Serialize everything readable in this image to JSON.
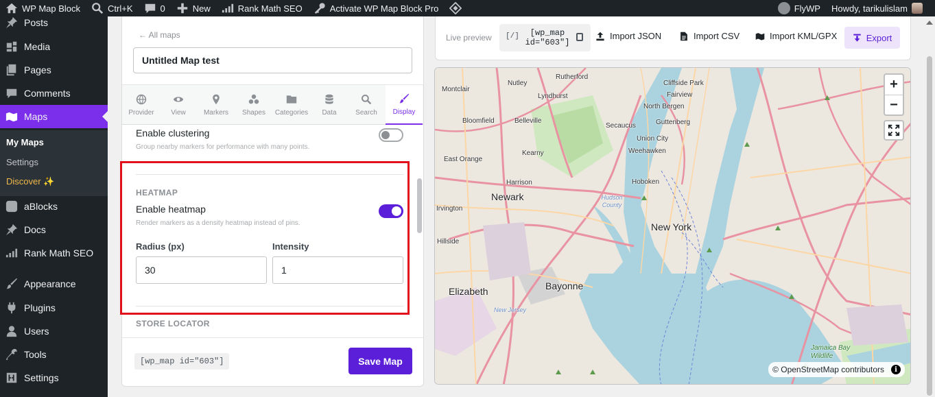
{
  "adminbar": {
    "site_name": "WP Map Block",
    "search_shortcut": "Ctrl+K",
    "comments_count": "0",
    "new_label": "New",
    "rank_math": "Rank Math SEO",
    "activate": "Activate WP Map Block Pro",
    "flywp": "FlyWP",
    "howdy": "Howdy, tarikulislam"
  },
  "sidebar": {
    "items": [
      {
        "label": "Posts",
        "icon": "pin-icon"
      },
      {
        "label": "Media",
        "icon": "media-icon"
      },
      {
        "label": "Pages",
        "icon": "pages-icon"
      },
      {
        "label": "Comments",
        "icon": "comments-icon"
      },
      {
        "label": "Maps",
        "icon": "maps-icon"
      },
      {
        "label": "aBlocks",
        "icon": "ablocks-icon"
      },
      {
        "label": "Docs",
        "icon": "pin-icon"
      },
      {
        "label": "Rank Math SEO",
        "icon": "rankmath-icon"
      },
      {
        "label": "Appearance",
        "icon": "brush-icon"
      },
      {
        "label": "Plugins",
        "icon": "plugins-icon"
      },
      {
        "label": "Users",
        "icon": "users-icon"
      },
      {
        "label": "Tools",
        "icon": "tools-icon"
      },
      {
        "label": "Settings",
        "icon": "settings-icon"
      }
    ],
    "submenu": {
      "my_maps": "My Maps",
      "settings": "Settings",
      "discover": "Discover ✨"
    }
  },
  "editor": {
    "back_link": "← All maps",
    "title_value": "Untitled Map test",
    "tabs": [
      {
        "label": "Provider",
        "icon": "globe-icon"
      },
      {
        "label": "View",
        "icon": "eye-icon"
      },
      {
        "label": "Markers",
        "icon": "marker-icon"
      },
      {
        "label": "Shapes",
        "icon": "shapes-icon"
      },
      {
        "label": "Categories",
        "icon": "folder-icon"
      },
      {
        "label": "Data",
        "icon": "database-icon"
      },
      {
        "label": "Search",
        "icon": "search-icon"
      },
      {
        "label": "Display",
        "icon": "brush-icon"
      }
    ],
    "clustering": {
      "label": "Enable clustering",
      "desc": "Group nearby markers for performance with many points.",
      "enabled": false
    },
    "heatmap": {
      "section_title": "HEATMAP",
      "label": "Enable heatmap",
      "desc": "Render markers as a density heatmap instead of pins.",
      "enabled": true,
      "radius_label": "Radius (px)",
      "radius_value": "30",
      "intensity_label": "Intensity",
      "intensity_value": "1"
    },
    "store_locator_title": "STORE LOCATOR",
    "footer": {
      "shortcode": "[wp_map id=\"603\"]",
      "save_label": "Save Map"
    }
  },
  "toolbar": {
    "live_preview": "Live preview",
    "shortcode_icon": "[/]",
    "shortcode_line1": "[wp_map",
    "shortcode_line2": "id=\"603\"]",
    "import_json": "Import JSON",
    "import_csv": "Import CSV",
    "import_kml": "Import KML/GPX",
    "export": "Export"
  },
  "map": {
    "zoom_in": "+",
    "zoom_out": "−",
    "attribution": "© OpenStreetMap contributors",
    "info": "i",
    "places": [
      {
        "name": "Rutherford",
        "kind": "town"
      },
      {
        "name": "Nutley",
        "kind": "town"
      },
      {
        "name": "Montclair",
        "kind": "town"
      },
      {
        "name": "Lyndhurst",
        "kind": "town"
      },
      {
        "name": "Cliffside Park",
        "kind": "town"
      },
      {
        "name": "Fairview",
        "kind": "town"
      },
      {
        "name": "Bloomfield",
        "kind": "town"
      },
      {
        "name": "Belleville",
        "kind": "town"
      },
      {
        "name": "North Bergen",
        "kind": "town"
      },
      {
        "name": "Secaucus",
        "kind": "town"
      },
      {
        "name": "Guttenberg",
        "kind": "town"
      },
      {
        "name": "Union City",
        "kind": "town"
      },
      {
        "name": "Kearny",
        "kind": "town"
      },
      {
        "name": "Weehawken",
        "kind": "town"
      },
      {
        "name": "East Orange",
        "kind": "town"
      },
      {
        "name": "Harrison",
        "kind": "town"
      },
      {
        "name": "Hoboken",
        "kind": "town"
      },
      {
        "name": "Newark",
        "kind": "city"
      },
      {
        "name": "Hudson County",
        "kind": "water"
      },
      {
        "name": "Irvington",
        "kind": "town"
      },
      {
        "name": "New York",
        "kind": "city"
      },
      {
        "name": "Hillside",
        "kind": "town"
      },
      {
        "name": "Bayonne",
        "kind": "city"
      },
      {
        "name": "Elizabeth",
        "kind": "city"
      },
      {
        "name": "New Jersey",
        "kind": "water"
      },
      {
        "name": "Jamaica Bay Wildlife",
        "kind": "green"
      }
    ]
  }
}
